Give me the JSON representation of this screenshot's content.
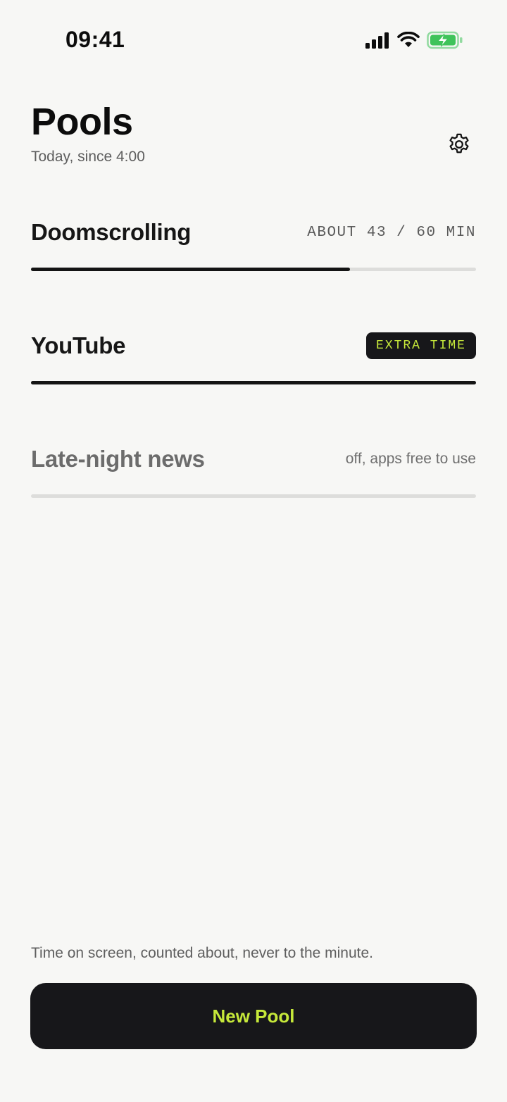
{
  "status_bar": {
    "time": "09:41",
    "icons": [
      "cellular-signal-icon",
      "wifi-icon",
      "battery-charging-icon"
    ],
    "battery_color": "#3fc35a"
  },
  "header": {
    "title": "Pools",
    "subtitle": "Today, since 4:00",
    "settings_icon": "gear-icon"
  },
  "pools": [
    {
      "name": "Doomscrolling",
      "meta": "ABOUT 43 / 60 MIN",
      "progress": 0.717
    },
    {
      "name": "YouTube",
      "badge": "EXTRA TIME",
      "progress": 1.0
    },
    {
      "name": "Late-night news",
      "meta": "off, apps free to use",
      "progress": 0
    }
  ],
  "footer": {
    "note": "Time on screen, counted about, never to the minute.",
    "new_pool_label": "New Pool"
  },
  "colors": {
    "background": "#f7f7f5",
    "accent": "#c6e83a",
    "button_dark": "#17171a"
  }
}
